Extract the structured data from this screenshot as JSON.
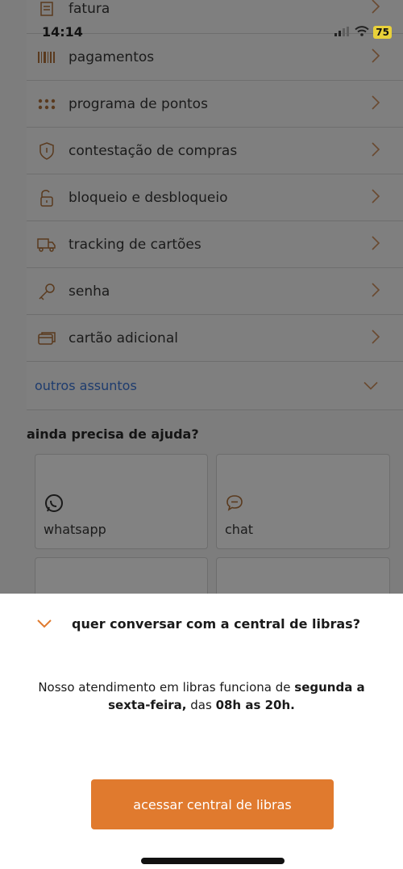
{
  "status_bar": {
    "time": "14:14",
    "battery": "75"
  },
  "menu": {
    "items": [
      {
        "label": "fatura",
        "icon": "document-icon"
      },
      {
        "label": "pagamentos",
        "icon": "barcode-icon"
      },
      {
        "label": "programa de pontos",
        "icon": "dots-icon"
      },
      {
        "label": "contestação de compras",
        "icon": "shield-icon"
      },
      {
        "label": "bloqueio e desbloqueio",
        "icon": "lock-icon"
      },
      {
        "label": "tracking de cartões",
        "icon": "truck-icon"
      },
      {
        "label": "senha",
        "icon": "key-icon"
      },
      {
        "label": "cartão adicional",
        "icon": "card-icon"
      }
    ],
    "other_label": "outros assuntos"
  },
  "help": {
    "title": "ainda precisa de ajuda?",
    "cards": [
      {
        "label": "whatsapp",
        "icon": "whatsapp-icon"
      },
      {
        "label": "chat",
        "icon": "chat-icon"
      }
    ]
  },
  "sheet": {
    "title": "quer conversar com a central de libras?",
    "body_pre": "Nosso atendimento em libras funciona de ",
    "body_b1": "segunda a sexta-feira,",
    "body_mid": " das ",
    "body_b2": "08h as 20h.",
    "cta_label": "acessar central de libras"
  },
  "colors": {
    "accent": "#e07a2e",
    "overlay": "#7d7d7d",
    "link": "#1e3c6e"
  }
}
